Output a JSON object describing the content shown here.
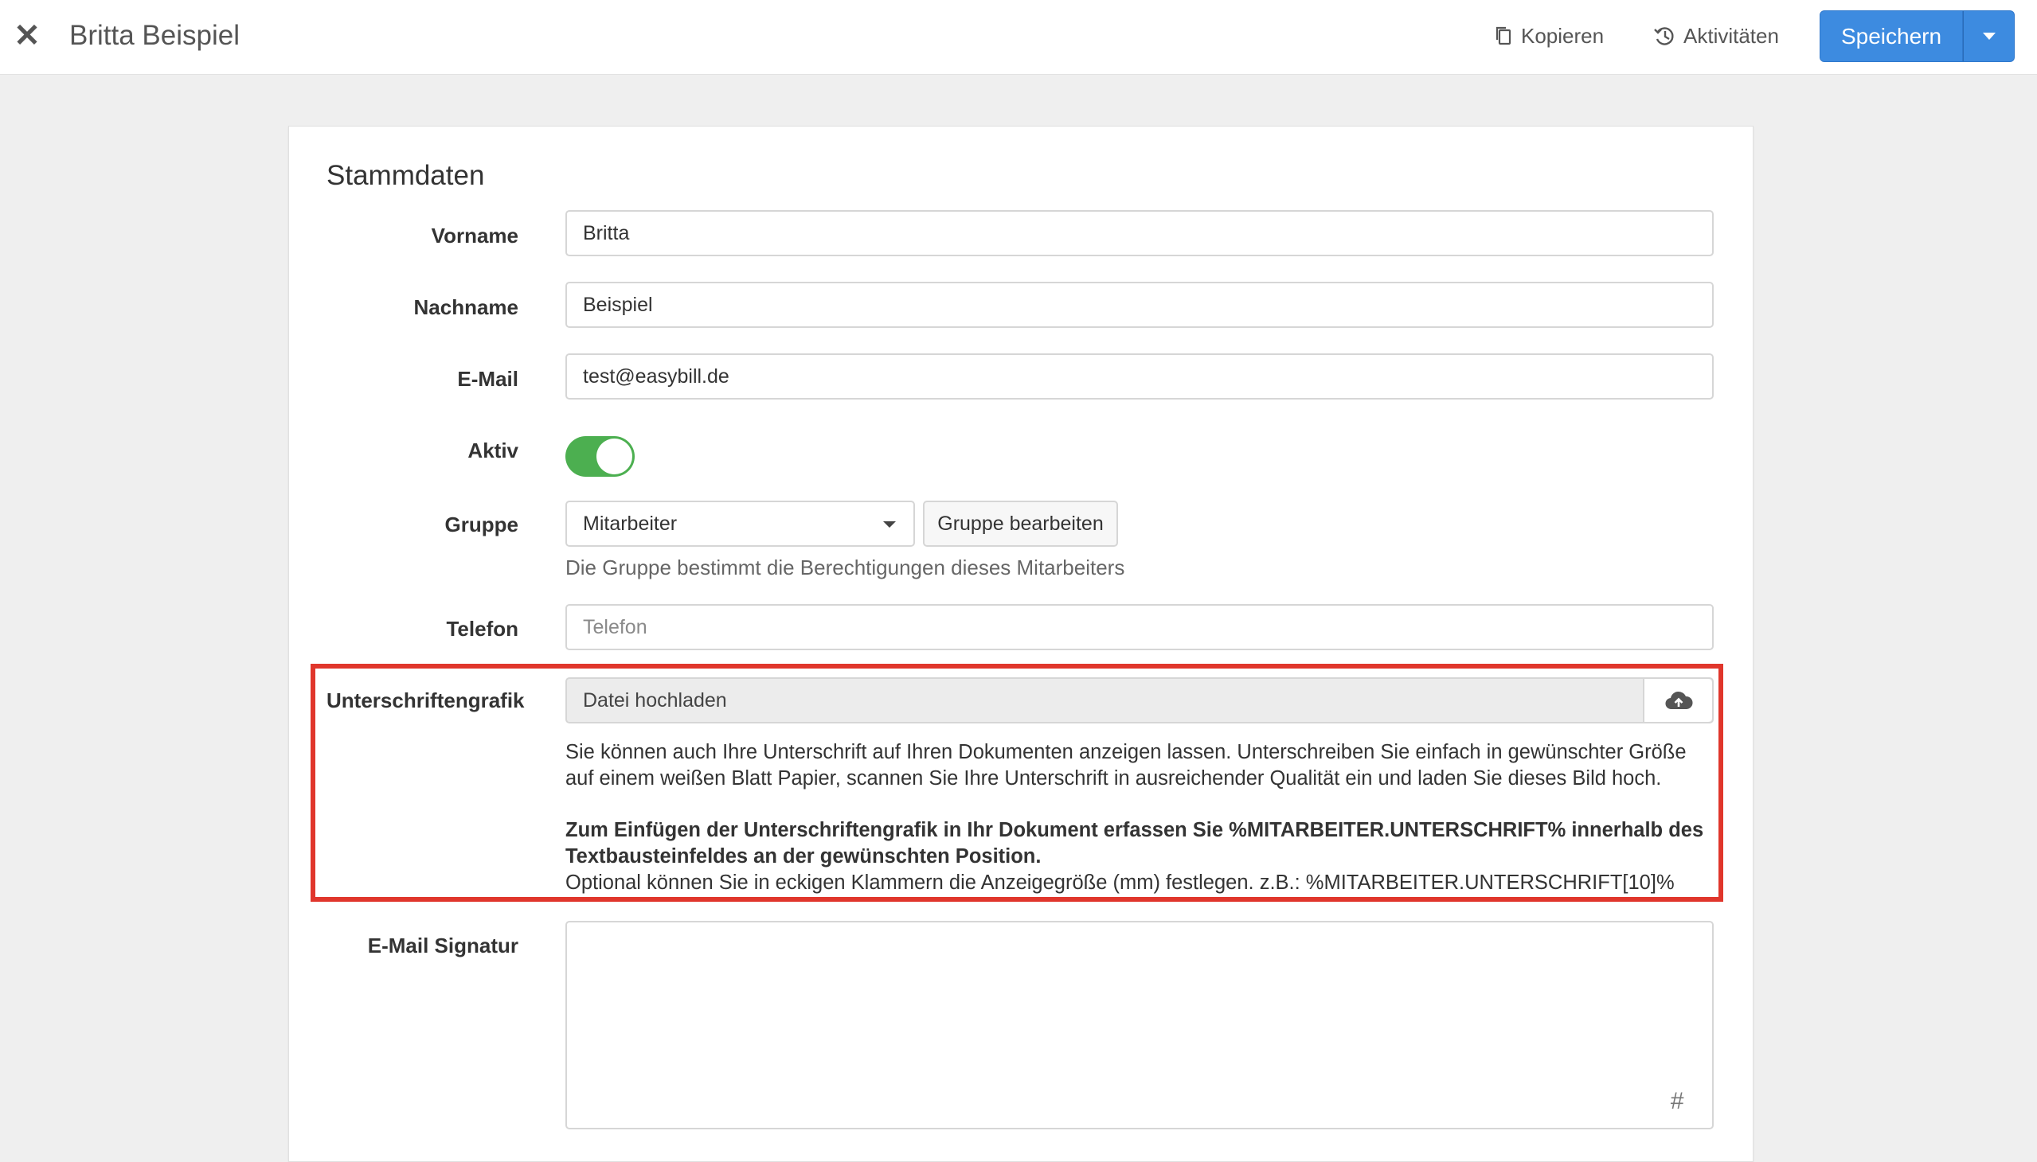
{
  "header": {
    "close_icon": "close-icon",
    "title": "Britta Beispiel",
    "copy_label": "Kopieren",
    "activities_label": "Aktivitäten",
    "save_label": "Speichern"
  },
  "form": {
    "section_title": "Stammdaten",
    "fields": {
      "vorname": {
        "label": "Vorname",
        "value": "Britta"
      },
      "nachname": {
        "label": "Nachname",
        "value": "Beispiel"
      },
      "email": {
        "label": "E-Mail",
        "value": "test@easybill.de"
      },
      "aktiv": {
        "label": "Aktiv",
        "checked": true
      },
      "gruppe": {
        "label": "Gruppe",
        "selected": "Mitarbeiter",
        "edit_label": "Gruppe bearbeiten",
        "help": "Die Gruppe bestimmt die Berechtigungen dieses Mitarbeiters"
      },
      "telefon": {
        "label": "Telefon",
        "value": "",
        "placeholder": "Telefon"
      },
      "unterschrift": {
        "label": "Unterschriftengrafik",
        "upload_text": "Datei hochladen",
        "info_line1": "Sie können auch Ihre Unterschrift auf Ihren Dokumenten anzeigen lassen. Unterschreiben Sie einfach in gewünschter Größe auf einem weißen Blatt Papier, scannen Sie Ihre Unterschrift in ausreichender Qualität ein und laden Sie dieses Bild hoch.",
        "info_bold": "Zum Einfügen der Unterschriftengrafik in Ihr Dokument erfassen Sie %MITARBEITER.UNTERSCHRIFT% innerhalb des Textbausteinfeldes an der gewünschten Position.",
        "info_optional": "Optional können Sie in eckigen Klammern die Anzeigegröße (mm) festlegen. z.B.: %MITARBEITER.UNTERSCHRIFT[10]%"
      },
      "signatur": {
        "label": "E-Mail Signatur",
        "value": "",
        "hash_symbol": "#"
      }
    }
  },
  "colors": {
    "primary": "#3d8be0",
    "toggle_on": "#4caf50",
    "highlight": "#e0362c",
    "background": "#efefef"
  }
}
